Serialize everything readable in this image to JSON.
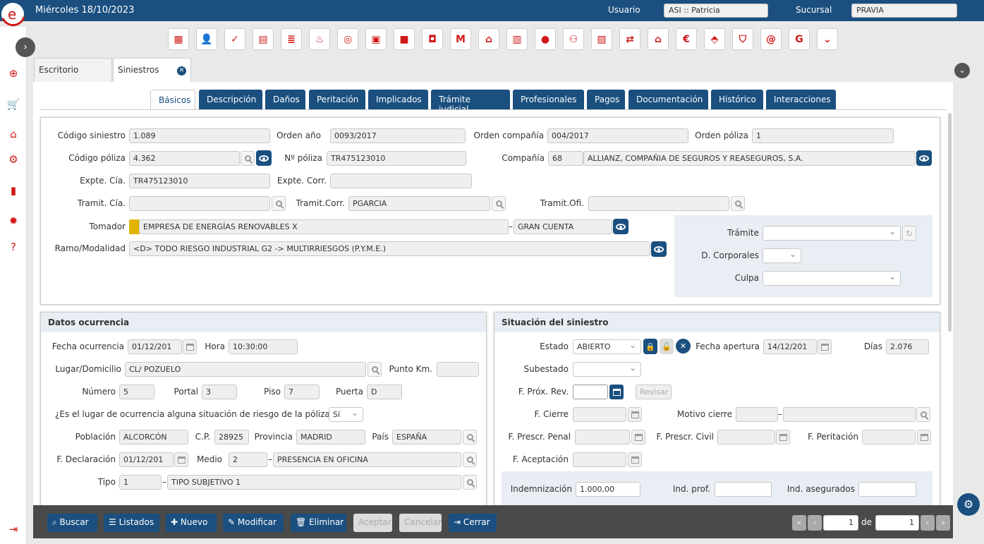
{
  "topbar": {
    "date": "Miércoles 18/10/2023",
    "usuario_label": "Usuario",
    "usuario_value": "ASI :: Patricia",
    "sucursal_label": "Sucursal",
    "sucursal_value": "PRAVIA"
  },
  "tabs": {
    "escritorio": "Escritorio",
    "siniestros": "Siniestros"
  },
  "subtabs": [
    "Básicos",
    "Descripción",
    "Daños",
    "Peritación",
    "Implicados",
    "Trámite judicial",
    "Profesionales",
    "Pagos",
    "Documentación",
    "Histórico",
    "Interacciones"
  ],
  "form": {
    "codigo_siniestro_label": "Código siniestro",
    "codigo_siniestro": "1.089",
    "orden_anio_label": "Orden año",
    "orden_anio": "0093/2017",
    "orden_compania_label": "Orden compañía",
    "orden_compania": "004/2017",
    "orden_poliza_label": "Orden póliza",
    "orden_poliza": "1",
    "codigo_poliza_label": "Código póliza",
    "codigo_poliza": "4.362",
    "n_poliza_label": "Nº póliza",
    "n_poliza": "TR475123010",
    "compania_label": "Compañía",
    "compania_code": "68",
    "compania_name": "ALLIANZ, COMPAÑIA DE SEGUROS Y REASEGUROS, S.A.",
    "expte_cia_label": "Expte. Cía.",
    "expte_cia": "TR475123010",
    "expte_corr_label": "Expte. Corr.",
    "expte_corr": "",
    "tramit_cia_label": "Tramit. Cía.",
    "tramit_cia": "",
    "tramit_corr_label": "Tramit.Corr.",
    "tramit_corr": "PGARCIA",
    "tramit_ofi_label": "Tramit.Ofi.",
    "tramit_ofi": "",
    "tomador_label": "Tomador",
    "tomador": "EMPRESA DE ENERGÍAS RENOVABLES X",
    "tomador_tipo": "GRAN CUENTA",
    "ramo_label": "Ramo/Modalidad",
    "ramo": "<D> TODO RIESGO INDUSTRIAL G2 -> MULTIRRIESGOS (P.Y.M.E.)",
    "tramite_label": "Trámite",
    "tramite": "",
    "dcorporales_label": "D. Corporales",
    "dcorporales": "",
    "culpa_label": "Culpa",
    "culpa": ""
  },
  "ocurrencia": {
    "title": "Datos ocurrencia",
    "fecha_label": "Fecha ocurrencia",
    "fecha": "01/12/201",
    "hora_label": "Hora",
    "hora": "10:30:00",
    "lugar_label": "Lugar/Domicilio",
    "lugar": "CL/ POZUELO",
    "puntokm_label": "Punto Km.",
    "puntokm": "",
    "numero_label": "Número",
    "numero": "5",
    "portal_label": "Portal",
    "portal": "3",
    "piso_label": "Piso",
    "piso": "7",
    "puerta_label": "Puerta",
    "puerta": "D",
    "riesgo_label": "¿Es el lugar de ocurrencia alguna situación de riesgo de la póliza?",
    "riesgo": "Sí",
    "poblacion_label": "Población",
    "poblacion": "ALCORCÓN",
    "cp_label": "C.P.",
    "cp": "28925",
    "provincia_label": "Provincia",
    "provincia": "MADRID",
    "pais_label": "País",
    "pais": "ESPAÑA",
    "fdecl_label": "F. Declaración",
    "fdecl": "01/12/201",
    "medio_label": "Medio",
    "medio_code": "2",
    "medio": "PRESENCIA EN OFICINA",
    "tipo_label": "Tipo",
    "tipo_code": "1",
    "tipo": "TIPO SUBJETIVO 1"
  },
  "situacion": {
    "title": "Situación del siniestro",
    "estado_label": "Estado",
    "estado": "ABIERTO",
    "fapertura_label": "Fecha apertura",
    "fapertura": "14/12/201",
    "dias_label": "Días",
    "dias": "2.076",
    "subestado_label": "Subestado",
    "subestado": "",
    "fproxrev_label": "F. Próx. Rev.",
    "fproxrev": "",
    "revisar_label": "Revisar",
    "fcierre_label": "F. Cierre",
    "fcierre": "",
    "motivo_label": "Motivo cierre",
    "motivo": "",
    "fprescpenal_label": "F. Prescr. Penal",
    "fprescivil_label": "F. Prescr. Civil",
    "fperitacion_label": "F. Peritación",
    "faceptacion_label": "F. Aceptación",
    "indemnizacion_label": "Indemnización",
    "indemnizacion": "1.000,00",
    "indprof_label": "Ind. prof.",
    "indprof": "",
    "indaseg_label": "Ind. asegurados",
    "indaseg": ""
  },
  "toolbar": {
    "buscar": "Buscar",
    "listados": "Listados",
    "nuevo": "Nuevo",
    "modificar": "Modificar",
    "eliminar": "Eliminar",
    "aceptar": "Aceptar",
    "cancelar": "Cancelar",
    "cerrar": "Cerrar",
    "page": "1",
    "de": "de",
    "total": "1"
  },
  "colors": {
    "brand": "#1a4f7f",
    "accent": "#d01818"
  }
}
